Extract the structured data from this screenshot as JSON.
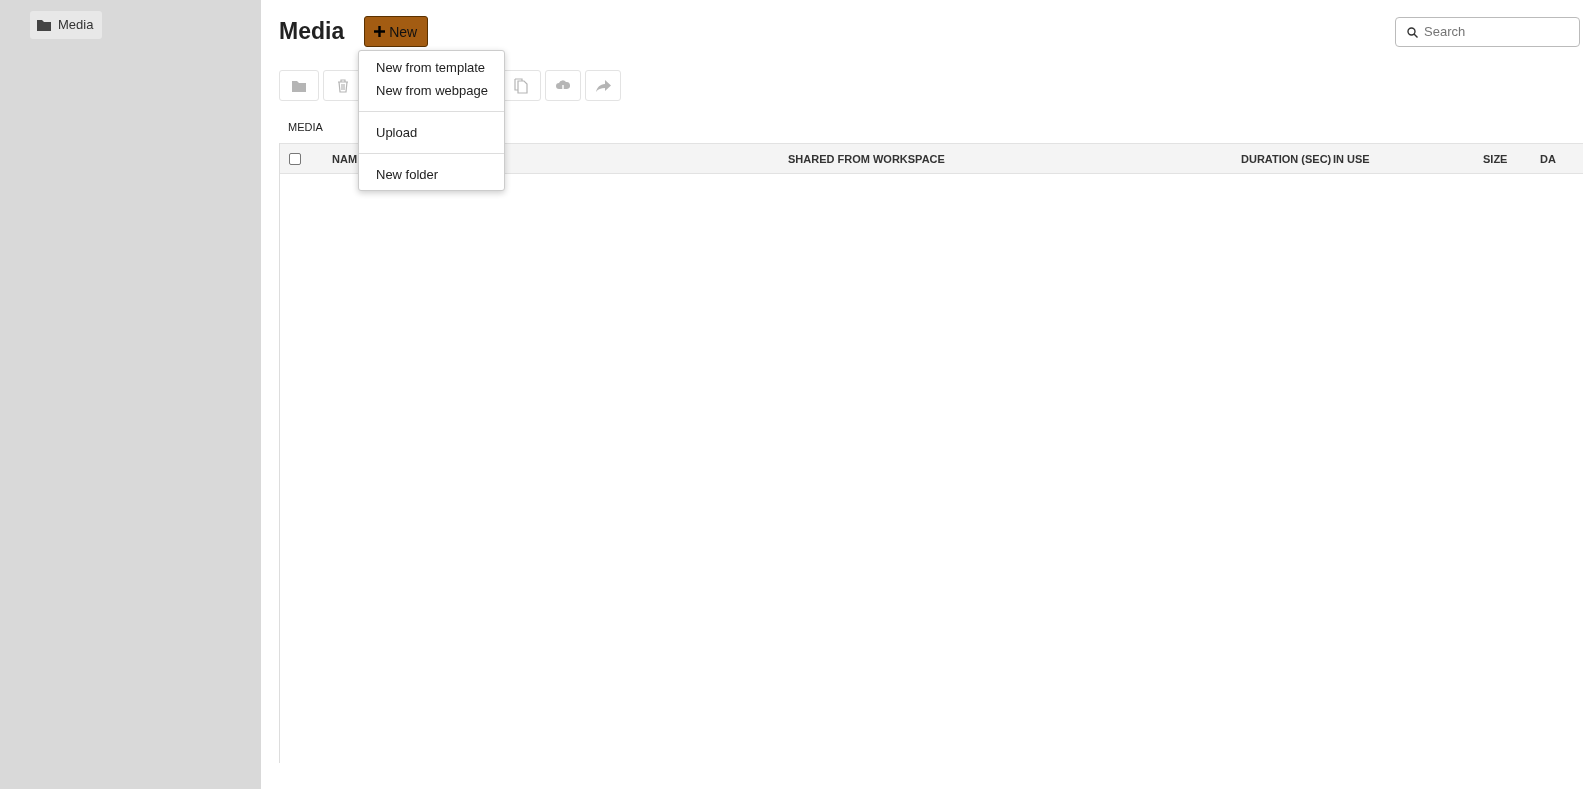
{
  "sidebar": {
    "items": [
      {
        "label": "Media",
        "selected": true
      }
    ]
  },
  "header": {
    "title": "Media",
    "new_button": "New"
  },
  "search": {
    "placeholder": "Search"
  },
  "toolbar": [
    {
      "kind": "folder"
    },
    {
      "kind": "trash"
    },
    {
      "kind": "copy"
    },
    {
      "kind": "cloud"
    },
    {
      "kind": "share"
    }
  ],
  "breadcrumb": "MEDIA",
  "table": {
    "select_all_checked": false,
    "columns": [
      "NAM",
      "SHARED FROM WORKSPACE",
      "DURATION (SEC)",
      "IN USE",
      "SIZE",
      "DA"
    ]
  },
  "menu": {
    "groups": [
      [
        "New from template",
        "New from webpage"
      ],
      [
        "Upload"
      ],
      [
        "New folder"
      ]
    ]
  }
}
